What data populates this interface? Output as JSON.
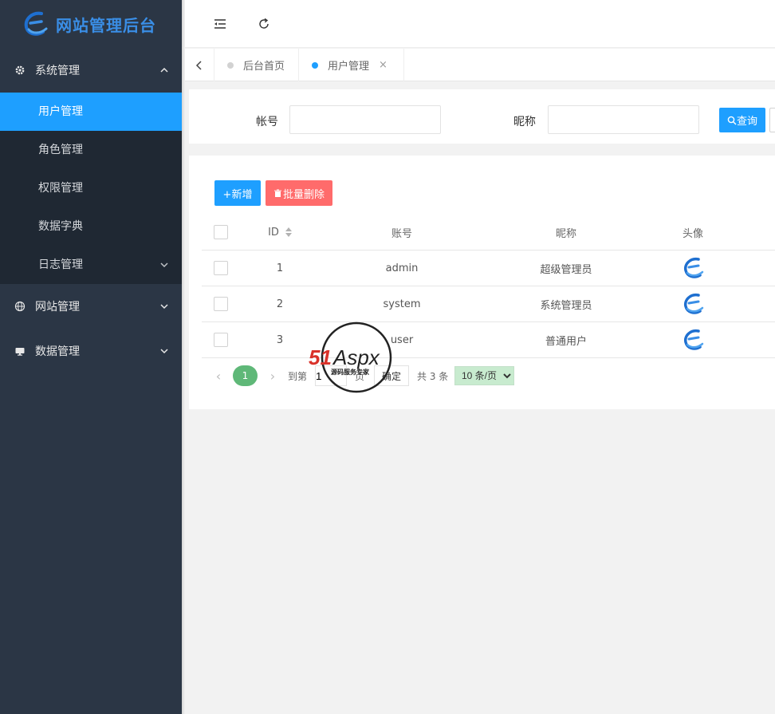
{
  "app": {
    "title": "网站管理后台",
    "logo_icon": "e-logo-icon",
    "accent": "#1e9fff",
    "sidebar_bg": "#2b3645"
  },
  "sidebar": {
    "groups": [
      {
        "label": "系统管理",
        "icon": "gear-icon",
        "expanded": true,
        "items": [
          {
            "label": "用户管理",
            "active": true
          },
          {
            "label": "角色管理"
          },
          {
            "label": "权限管理"
          },
          {
            "label": "数据字典"
          },
          {
            "label": "日志管理",
            "has_children": true
          }
        ]
      },
      {
        "label": "网站管理",
        "icon": "globe-icon",
        "expanded": false
      },
      {
        "label": "数据管理",
        "icon": "monitor-icon",
        "expanded": false
      }
    ]
  },
  "header": {
    "menu_toggle_icon": "indent-icon",
    "refresh_icon": "refresh-icon"
  },
  "tabs": {
    "prev_icon": "chevron-left-icon",
    "items": [
      {
        "label": "后台首页",
        "active": false
      },
      {
        "label": "用户管理",
        "active": true,
        "closable": true,
        "close_glyph": "×"
      }
    ]
  },
  "search": {
    "account_label": "帐号",
    "account_value": "",
    "nickname_label": "昵称",
    "nickname_value": "",
    "query_button": "查询",
    "query_icon": "search-icon"
  },
  "toolbar": {
    "add_button": "+新增",
    "batch_delete_button": "批量删除",
    "delete_icon": "trash-icon"
  },
  "table": {
    "columns": [
      "ID",
      "账号",
      "昵称",
      "头像"
    ],
    "rows": [
      {
        "id": "1",
        "account": "admin",
        "nickname": "超级管理员"
      },
      {
        "id": "2",
        "account": "system",
        "nickname": "系统管理员"
      },
      {
        "id": "3",
        "account": "user",
        "nickname": "普通用户"
      }
    ]
  },
  "pager": {
    "current_page": "1",
    "goto_label": "到第",
    "goto_value": "1",
    "page_suffix": "页",
    "confirm_button": "确定",
    "total_text": "共 3 条",
    "page_size": "10 条/页",
    "page_size_options": [
      "10 条/页"
    ]
  },
  "watermark": {
    "brand_51": "51",
    "brand_aspx": "Aspx",
    "tagline": "源码服务专家"
  }
}
